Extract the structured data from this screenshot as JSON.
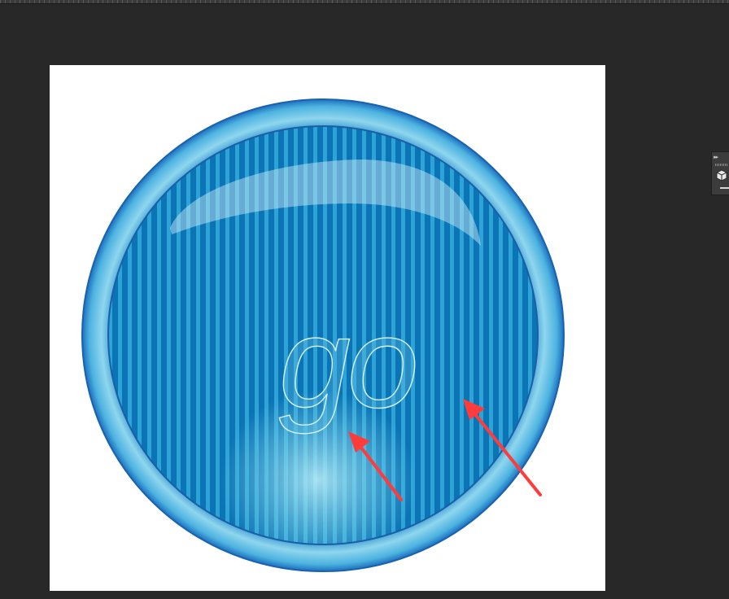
{
  "app": {
    "background_color": "#282828"
  },
  "document": {
    "button_text": "go",
    "colors": {
      "canvas": "#ffffff",
      "ring_outer": "#1d6fbf",
      "ring_light": "#8fd6ee",
      "inner_dark": "#0a6fb0",
      "stripe_light": "#2f9fd6",
      "arrow": "#ff4040"
    }
  },
  "panel": {
    "collapse_icon": "double-chevron-right-icon",
    "tool_icon": "3d-cube-icon"
  }
}
